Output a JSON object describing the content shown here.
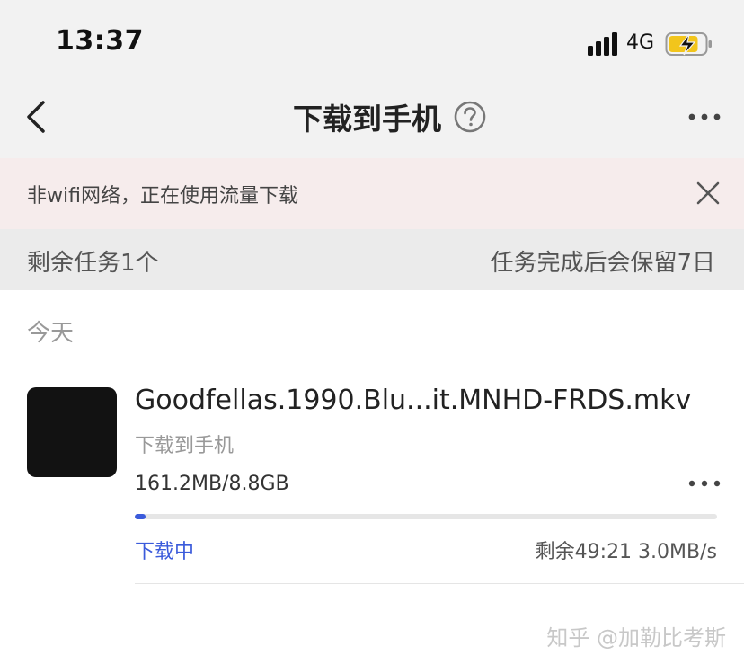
{
  "status_bar": {
    "time": "13:37",
    "network": "4G",
    "icons": [
      "signal-icon",
      "battery-charging-icon"
    ]
  },
  "nav": {
    "title": "下载到手机",
    "back_icon": "chevron-left-icon",
    "help_icon": "question-circle-icon",
    "more_icon": "more-horizontal-icon"
  },
  "warning": {
    "text": "非wifi网络，正在使用流量下载",
    "close_icon": "close-icon"
  },
  "task_bar": {
    "remaining": "剩余任务1个",
    "retention": "任务完成后会保留7日"
  },
  "section": {
    "label": "今天"
  },
  "download": {
    "file_name": "Goodfellas.1990.Blu...it.MNHD-FRDS.mkv",
    "destination": "下载到手机",
    "size": "161.2MB/8.8GB",
    "progress_fraction": 0.018,
    "status": "下载中",
    "remaining": "剩余49:21 3.0MB/s"
  },
  "watermark": "知乎 @加勒比考斯",
  "colors": {
    "accent": "#3b5bdb",
    "banner_bg": "#f6ecec",
    "header_bg": "#f2f2f2",
    "task_bar_bg": "#ebebeb"
  }
}
